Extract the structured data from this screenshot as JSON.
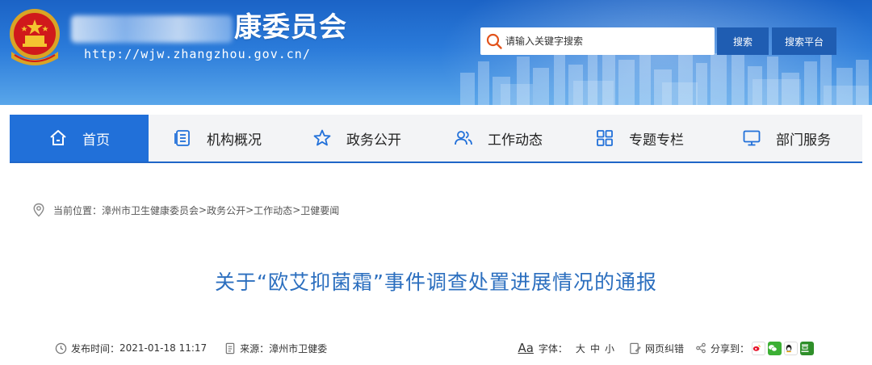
{
  "header": {
    "site_title": "康委员会",
    "site_url": "http://wjw.zhangzhou.gov.cn/",
    "search_placeholder": "请输入关键字搜索",
    "search_button": "搜索",
    "platform_button": "搜索平台"
  },
  "nav": {
    "items": [
      {
        "label": "首页",
        "icon": "home-icon"
      },
      {
        "label": "机构概况",
        "icon": "document-list-icon"
      },
      {
        "label": "政务公开",
        "icon": "star-icon"
      },
      {
        "label": "工作动态",
        "icon": "people-icon"
      },
      {
        "label": "专题专栏",
        "icon": "grid-icon"
      },
      {
        "label": "部门服务",
        "icon": "monitor-icon"
      }
    ]
  },
  "breadcrumb": {
    "prefix": "当前位置：",
    "items": [
      "漳州市卫生健康委员会",
      "政务公开",
      "工作动态",
      "卫健要闻"
    ],
    "separator": ">"
  },
  "article": {
    "title": "关于“欧艾抑菌霜”事件调查处置进展情况的通报"
  },
  "meta": {
    "publish_label": "发布时间：",
    "publish_time": "2021-01-18 11:17",
    "source_label": "来源：",
    "source": "漳州市卫健委",
    "aa": "Aa",
    "font_label": "字体：",
    "font_large": "大",
    "font_medium": "中",
    "font_small": "小",
    "error_report": "网页纠错",
    "share_label": "分享到：",
    "share_icons": [
      "weibo-icon",
      "wechat-icon",
      "qq-icon",
      "douban-icon"
    ]
  },
  "colors": {
    "banner_blue": "#2a7ad9",
    "nav_active": "#2170d9",
    "title_blue": "#2c6fbf",
    "button_blue": "#1f5db2"
  }
}
